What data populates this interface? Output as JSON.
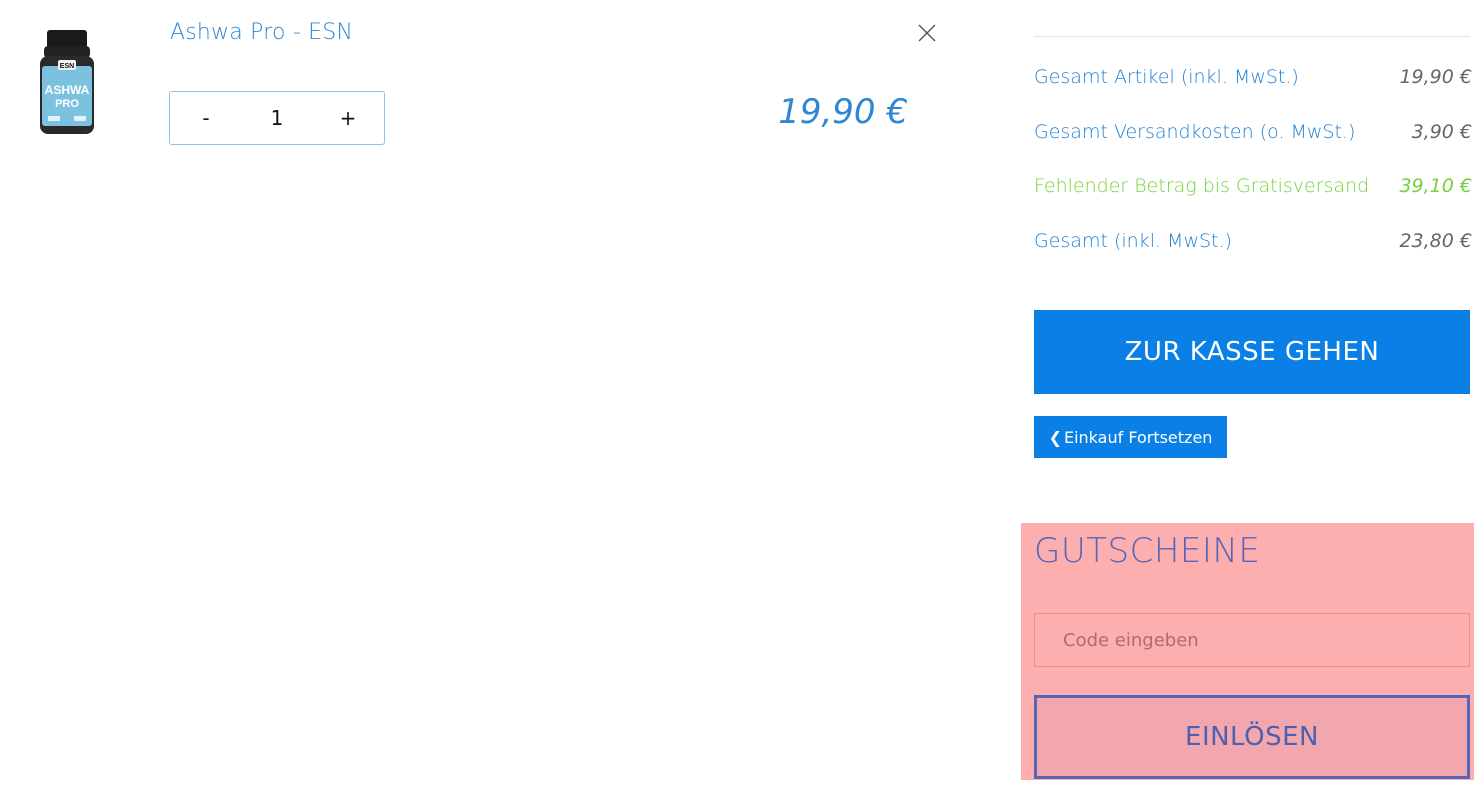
{
  "cart_item": {
    "name": "Ashwa Pro - ESN",
    "thumb_brand": "ESN",
    "thumb_line1": "ASHWA",
    "thumb_line2": "PRO",
    "quantity": "1",
    "decrement_label": "-",
    "increment_label": "+",
    "price": "19,90 €"
  },
  "summary": {
    "rows": [
      {
        "label": "Gesamt Artikel (inkl. MwSt.)",
        "value": "19,90 €"
      },
      {
        "label": "Gesamt Versandkosten (o. MwSt.)",
        "value": "3,90 €"
      },
      {
        "label": "Fehlender Betrag bis Gratisversand",
        "value": "39,10 €"
      },
      {
        "label": "Gesamt (inkl. MwSt.)",
        "value": "23,80 €"
      }
    ],
    "checkout_label": "ZUR KASSE GEHEN",
    "continue_label": "Einkauf Fortsetzen"
  },
  "voucher": {
    "title": "GUTSCHEINE",
    "placeholder": "Code eingeben",
    "redeem_label": "EINLÖSEN"
  },
  "colors": {
    "accent": "#0a80e6",
    "link": "#2f86d2",
    "success": "#76d13a",
    "voucher_bg": "#fdaeae",
    "voucher_text": "#5566b8"
  }
}
